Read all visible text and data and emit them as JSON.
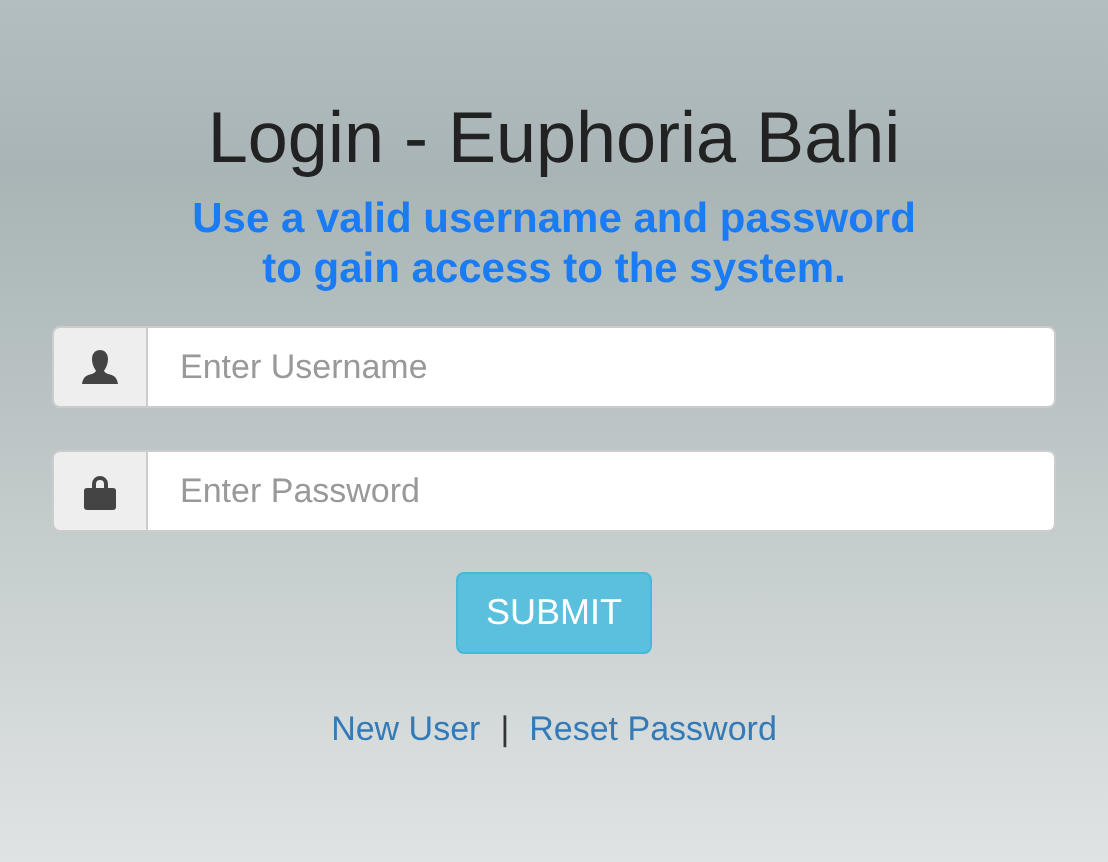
{
  "title": "Login - Euphoria Bahi",
  "subtitle_lines": [
    "Use a valid username and password",
    "to gain access to the system."
  ],
  "fields": [
    {
      "kind": "user",
      "placeholder": "Enter Username"
    },
    {
      "kind": "lock",
      "placeholder": "Enter Password"
    }
  ],
  "submit_button": "SUBMIT",
  "links": [
    "New User",
    "Reset Password"
  ],
  "separator": "|"
}
